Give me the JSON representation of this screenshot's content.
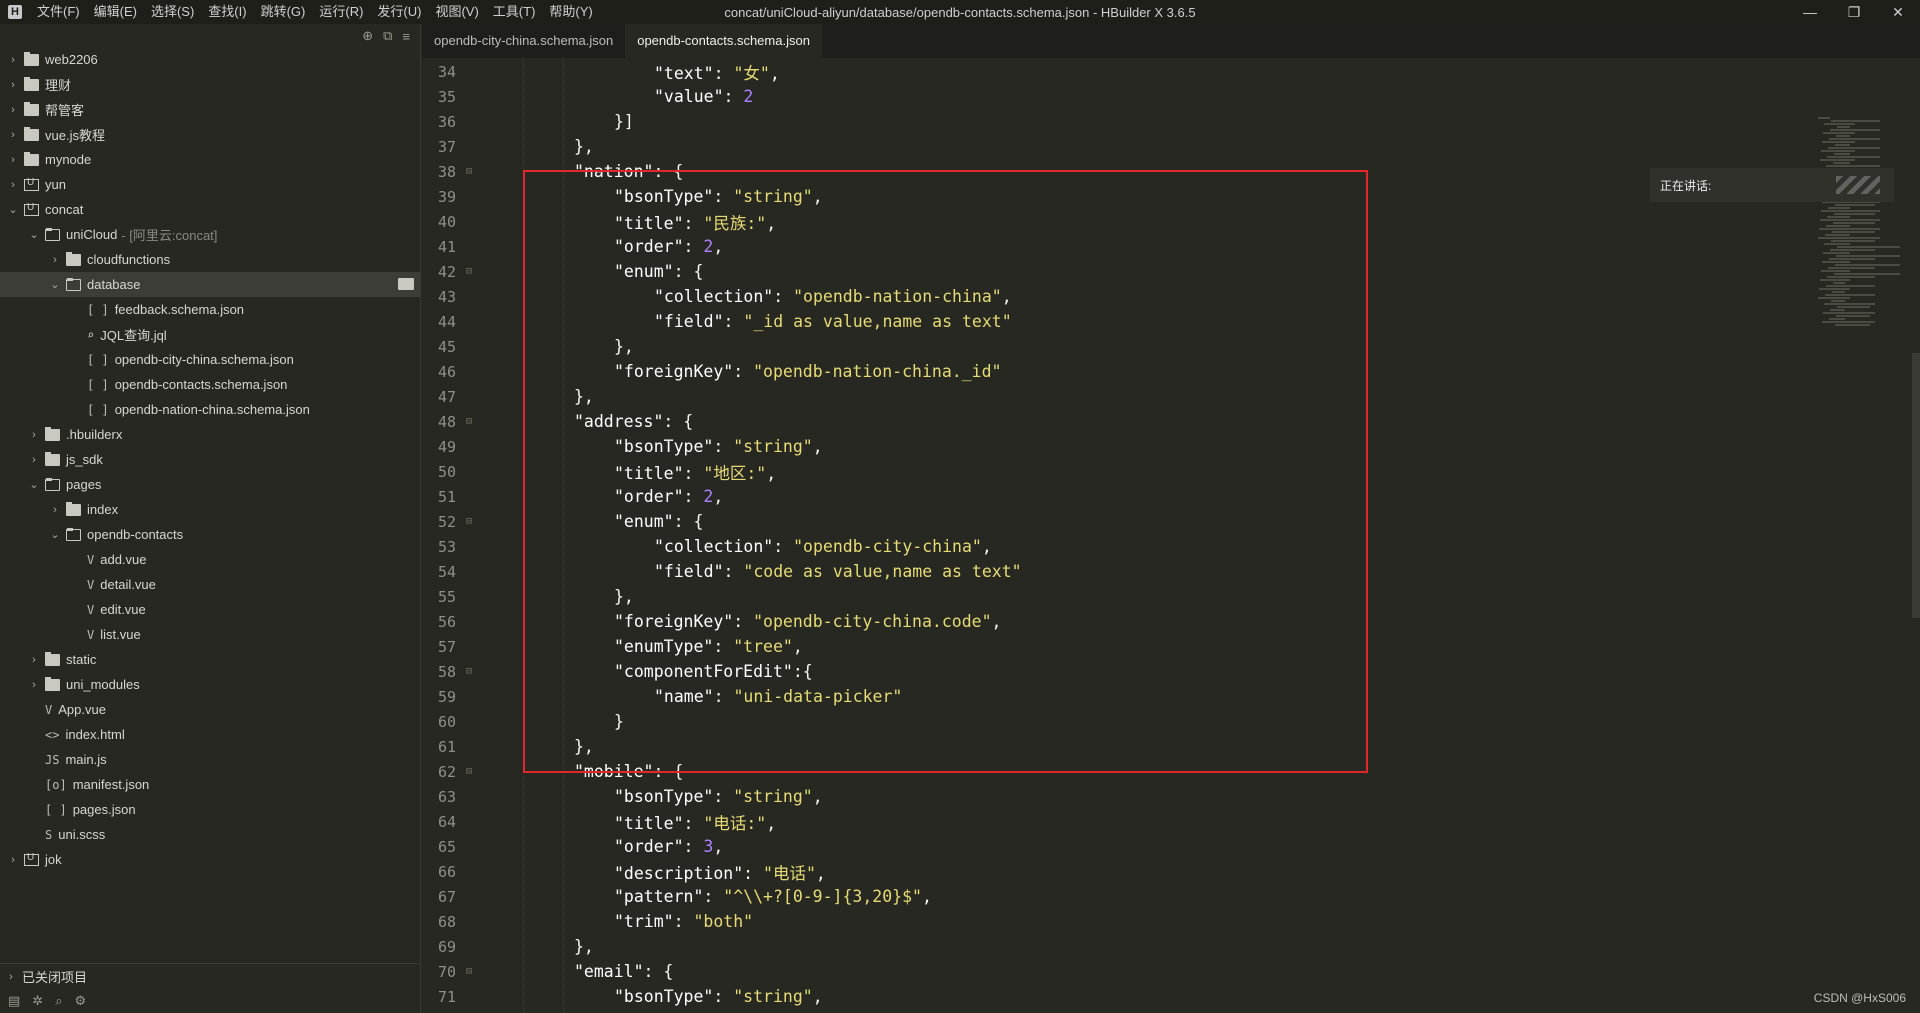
{
  "app": {
    "logo": "H",
    "window_title": "concat/uniCloud-aliyun/database/opendb-contacts.schema.json - HBuilder X 3.6.5",
    "menu": [
      "文件(F)",
      "编辑(E)",
      "选择(S)",
      "查找(I)",
      "跳转(G)",
      "运行(R)",
      "发行(U)",
      "视图(V)",
      "工具(T)",
      "帮助(Y)"
    ],
    "window_buttons": {
      "minimize": "—",
      "restore": "❐",
      "close": "✕"
    }
  },
  "sidebar": {
    "top_icons": [
      "⊕",
      "⧉",
      "≡"
    ],
    "tree": [
      {
        "depth": 0,
        "arrow": "›",
        "icon": "folder",
        "label": "web2206"
      },
      {
        "depth": 0,
        "arrow": "›",
        "icon": "folder",
        "label": "理财"
      },
      {
        "depth": 0,
        "arrow": "›",
        "icon": "folder",
        "label": "帮管客"
      },
      {
        "depth": 0,
        "arrow": "›",
        "icon": "folder",
        "label": "vue.js教程"
      },
      {
        "depth": 0,
        "arrow": "›",
        "icon": "folder",
        "label": "mynode"
      },
      {
        "depth": 0,
        "arrow": "›",
        "icon": "proj",
        "label": "yun"
      },
      {
        "depth": 0,
        "arrow": "⌄",
        "icon": "proj",
        "label": "concat"
      },
      {
        "depth": 1,
        "arrow": "⌄",
        "icon": "folder-open",
        "label": "uniCloud",
        "suffix": "- [阿里云:concat]"
      },
      {
        "depth": 2,
        "arrow": "›",
        "icon": "folder",
        "label": "cloudfunctions"
      },
      {
        "depth": 2,
        "arrow": "⌄",
        "icon": "folder-open",
        "label": "database",
        "selected": true
      },
      {
        "depth": 3,
        "arrow": "",
        "icon": "[ ]",
        "label": "feedback.schema.json"
      },
      {
        "depth": 3,
        "arrow": "",
        "icon": "⌕",
        "label": "JQL查询.jql"
      },
      {
        "depth": 3,
        "arrow": "",
        "icon": "[ ]",
        "label": "opendb-city-china.schema.json"
      },
      {
        "depth": 3,
        "arrow": "",
        "icon": "[ ]",
        "label": "opendb-contacts.schema.json"
      },
      {
        "depth": 3,
        "arrow": "",
        "icon": "[ ]",
        "label": "opendb-nation-china.schema.json"
      },
      {
        "depth": 1,
        "arrow": "›",
        "icon": "folder",
        "label": ".hbuilderx"
      },
      {
        "depth": 1,
        "arrow": "›",
        "icon": "folder",
        "label": "js_sdk"
      },
      {
        "depth": 1,
        "arrow": "⌄",
        "icon": "folder-open",
        "label": "pages"
      },
      {
        "depth": 2,
        "arrow": "›",
        "icon": "folder",
        "label": "index"
      },
      {
        "depth": 2,
        "arrow": "⌄",
        "icon": "folder-open",
        "label": "opendb-contacts"
      },
      {
        "depth": 3,
        "arrow": "",
        "icon": "V",
        "label": "add.vue"
      },
      {
        "depth": 3,
        "arrow": "",
        "icon": "V",
        "label": "detail.vue"
      },
      {
        "depth": 3,
        "arrow": "",
        "icon": "V",
        "label": "edit.vue"
      },
      {
        "depth": 3,
        "arrow": "",
        "icon": "V",
        "label": "list.vue"
      },
      {
        "depth": 1,
        "arrow": "›",
        "icon": "folder",
        "label": "static"
      },
      {
        "depth": 1,
        "arrow": "›",
        "icon": "folder",
        "label": "uni_modules"
      },
      {
        "depth": 1,
        "arrow": "",
        "icon": "V",
        "label": "App.vue"
      },
      {
        "depth": 1,
        "arrow": "",
        "icon": "<>",
        "label": "index.html"
      },
      {
        "depth": 1,
        "arrow": "",
        "icon": "JS",
        "label": "main.js"
      },
      {
        "depth": 1,
        "arrow": "",
        "icon": "[o]",
        "label": "manifest.json"
      },
      {
        "depth": 1,
        "arrow": "",
        "icon": "[ ]",
        "label": "pages.json"
      },
      {
        "depth": 1,
        "arrow": "",
        "icon": "S",
        "label": "uni.scss"
      },
      {
        "depth": 0,
        "arrow": "›",
        "icon": "proj",
        "label": "jok"
      }
    ],
    "closed_projects": "已关闭项目",
    "footer_icons": [
      "▤",
      "✲",
      "⌕",
      "⚙"
    ]
  },
  "tabs": [
    {
      "label": "opendb-city-china.schema.json",
      "active": false
    },
    {
      "label": "opendb-contacts.schema.json",
      "active": true
    }
  ],
  "editor": {
    "lines": [
      {
        "n": "34",
        "fold": "",
        "indent": 4,
        "parts": [
          [
            "k",
            "\"text\""
          ],
          [
            "p",
            ": "
          ],
          [
            "s",
            "\"女\""
          ],
          [
            "p",
            ","
          ]
        ]
      },
      {
        "n": "35",
        "fold": "",
        "indent": 4,
        "parts": [
          [
            "k",
            "\"value\""
          ],
          [
            "p",
            ": "
          ],
          [
            "n",
            "2"
          ]
        ]
      },
      {
        "n": "36",
        "fold": "",
        "indent": 3,
        "parts": [
          [
            "p",
            "}]"
          ]
        ]
      },
      {
        "n": "37",
        "fold": "",
        "indent": 2,
        "parts": [
          [
            "p",
            "},"
          ]
        ]
      },
      {
        "n": "38",
        "fold": "⊟",
        "indent": 2,
        "parts": [
          [
            "k",
            "\"nation\""
          ],
          [
            "p",
            ": {"
          ]
        ]
      },
      {
        "n": "39",
        "fold": "",
        "indent": 3,
        "parts": [
          [
            "k",
            "\"bsonType\""
          ],
          [
            "p",
            ": "
          ],
          [
            "s",
            "\"string\""
          ],
          [
            "p",
            ","
          ]
        ]
      },
      {
        "n": "40",
        "fold": "",
        "indent": 3,
        "parts": [
          [
            "k",
            "\"title\""
          ],
          [
            "p",
            ": "
          ],
          [
            "s",
            "\"民族:\""
          ],
          [
            "p",
            ","
          ]
        ]
      },
      {
        "n": "41",
        "fold": "",
        "indent": 3,
        "parts": [
          [
            "k",
            "\"order\""
          ],
          [
            "p",
            ": "
          ],
          [
            "n",
            "2"
          ],
          [
            "p",
            ","
          ]
        ]
      },
      {
        "n": "42",
        "fold": "⊟",
        "indent": 3,
        "parts": [
          [
            "k",
            "\"enum\""
          ],
          [
            "p",
            ": {"
          ]
        ]
      },
      {
        "n": "43",
        "fold": "",
        "indent": 4,
        "parts": [
          [
            "k",
            "\"collection\""
          ],
          [
            "p",
            ": "
          ],
          [
            "s",
            "\"opendb-nation-china\""
          ],
          [
            "p",
            ","
          ]
        ]
      },
      {
        "n": "44",
        "fold": "",
        "indent": 4,
        "parts": [
          [
            "k",
            "\"field\""
          ],
          [
            "p",
            ": "
          ],
          [
            "s",
            "\"_id as value,name as text\""
          ]
        ]
      },
      {
        "n": "45",
        "fold": "",
        "indent": 3,
        "parts": [
          [
            "p",
            "},"
          ]
        ]
      },
      {
        "n": "46",
        "fold": "",
        "indent": 3,
        "parts": [
          [
            "k",
            "\"foreignKey\""
          ],
          [
            "p",
            ": "
          ],
          [
            "s",
            "\"opendb-nation-china._id\""
          ]
        ]
      },
      {
        "n": "47",
        "fold": "",
        "indent": 2,
        "parts": [
          [
            "p",
            "},"
          ]
        ]
      },
      {
        "n": "48",
        "fold": "⊟",
        "indent": 2,
        "parts": [
          [
            "k",
            "\"address\""
          ],
          [
            "p",
            ": {"
          ]
        ]
      },
      {
        "n": "49",
        "fold": "",
        "indent": 3,
        "parts": [
          [
            "k",
            "\"bsonType\""
          ],
          [
            "p",
            ": "
          ],
          [
            "s",
            "\"string\""
          ],
          [
            "p",
            ","
          ]
        ]
      },
      {
        "n": "50",
        "fold": "",
        "indent": 3,
        "parts": [
          [
            "k",
            "\"title\""
          ],
          [
            "p",
            ": "
          ],
          [
            "s",
            "\"地区:\""
          ],
          [
            "p",
            ","
          ]
        ]
      },
      {
        "n": "51",
        "fold": "",
        "indent": 3,
        "parts": [
          [
            "k",
            "\"order\""
          ],
          [
            "p",
            ": "
          ],
          [
            "n",
            "2"
          ],
          [
            "p",
            ","
          ]
        ]
      },
      {
        "n": "52",
        "fold": "⊟",
        "indent": 3,
        "parts": [
          [
            "k",
            "\"enum\""
          ],
          [
            "p",
            ": {"
          ]
        ]
      },
      {
        "n": "53",
        "fold": "",
        "indent": 4,
        "parts": [
          [
            "k",
            "\"collection\""
          ],
          [
            "p",
            ": "
          ],
          [
            "s",
            "\"opendb-city-china\""
          ],
          [
            "p",
            ","
          ]
        ]
      },
      {
        "n": "54",
        "fold": "",
        "indent": 4,
        "parts": [
          [
            "k",
            "\"field\""
          ],
          [
            "p",
            ": "
          ],
          [
            "s",
            "\"code as value,name as text\""
          ]
        ]
      },
      {
        "n": "55",
        "fold": "",
        "indent": 3,
        "parts": [
          [
            "p",
            "},"
          ]
        ]
      },
      {
        "n": "56",
        "fold": "",
        "indent": 3,
        "parts": [
          [
            "k",
            "\"foreignKey\""
          ],
          [
            "p",
            ": "
          ],
          [
            "s",
            "\"opendb-city-china.code\""
          ],
          [
            "p",
            ","
          ]
        ]
      },
      {
        "n": "57",
        "fold": "",
        "indent": 3,
        "parts": [
          [
            "k",
            "\"enumType\""
          ],
          [
            "p",
            ": "
          ],
          [
            "s",
            "\"tree\""
          ],
          [
            "p",
            ","
          ]
        ]
      },
      {
        "n": "58",
        "fold": "⊟",
        "indent": 3,
        "parts": [
          [
            "k",
            "\"componentForEdit\""
          ],
          [
            "p",
            ":{"
          ]
        ]
      },
      {
        "n": "59",
        "fold": "",
        "indent": 4,
        "parts": [
          [
            "k",
            "\"name\""
          ],
          [
            "p",
            ": "
          ],
          [
            "s",
            "\"uni-data-picker\""
          ]
        ]
      },
      {
        "n": "60",
        "fold": "",
        "indent": 3,
        "parts": [
          [
            "p",
            "}"
          ]
        ]
      },
      {
        "n": "61",
        "fold": "",
        "indent": 2,
        "parts": [
          [
            "p",
            "},"
          ]
        ]
      },
      {
        "n": "62",
        "fold": "⊟",
        "indent": 2,
        "parts": [
          [
            "k",
            "\"mobile\""
          ],
          [
            "p",
            ": {"
          ]
        ]
      },
      {
        "n": "63",
        "fold": "",
        "indent": 3,
        "parts": [
          [
            "k",
            "\"bsonType\""
          ],
          [
            "p",
            ": "
          ],
          [
            "s",
            "\"string\""
          ],
          [
            "p",
            ","
          ]
        ]
      },
      {
        "n": "64",
        "fold": "",
        "indent": 3,
        "parts": [
          [
            "k",
            "\"title\""
          ],
          [
            "p",
            ": "
          ],
          [
            "s",
            "\"电话:\""
          ],
          [
            "p",
            ","
          ]
        ]
      },
      {
        "n": "65",
        "fold": "",
        "indent": 3,
        "parts": [
          [
            "k",
            "\"order\""
          ],
          [
            "p",
            ": "
          ],
          [
            "n",
            "3"
          ],
          [
            "p",
            ","
          ]
        ]
      },
      {
        "n": "66",
        "fold": "",
        "indent": 3,
        "parts": [
          [
            "k",
            "\"description\""
          ],
          [
            "p",
            ": "
          ],
          [
            "s",
            "\"电话\""
          ],
          [
            "p",
            ","
          ]
        ]
      },
      {
        "n": "67",
        "fold": "",
        "indent": 3,
        "parts": [
          [
            "k",
            "\"pattern\""
          ],
          [
            "p",
            ": "
          ],
          [
            "s",
            "\"^\\\\+?[0-9-]{3,20}$\""
          ],
          [
            "p",
            ","
          ]
        ]
      },
      {
        "n": "68",
        "fold": "",
        "indent": 3,
        "parts": [
          [
            "k",
            "\"trim\""
          ],
          [
            "p",
            ": "
          ],
          [
            "s",
            "\"both\""
          ]
        ]
      },
      {
        "n": "69",
        "fold": "",
        "indent": 2,
        "parts": [
          [
            "p",
            "},"
          ]
        ]
      },
      {
        "n": "70",
        "fold": "⊟",
        "indent": 2,
        "parts": [
          [
            "k",
            "\"email\""
          ],
          [
            "p",
            ": {"
          ]
        ]
      },
      {
        "n": "71",
        "fold": "",
        "indent": 3,
        "parts": [
          [
            "k",
            "\"bsonType\""
          ],
          [
            "p",
            ": "
          ],
          [
            "s",
            "\"string\""
          ],
          [
            "p",
            ","
          ]
        ]
      }
    ]
  },
  "overlay": {
    "speaking_label": "正在讲话:",
    "watermark": "CSDN @HxS006"
  }
}
